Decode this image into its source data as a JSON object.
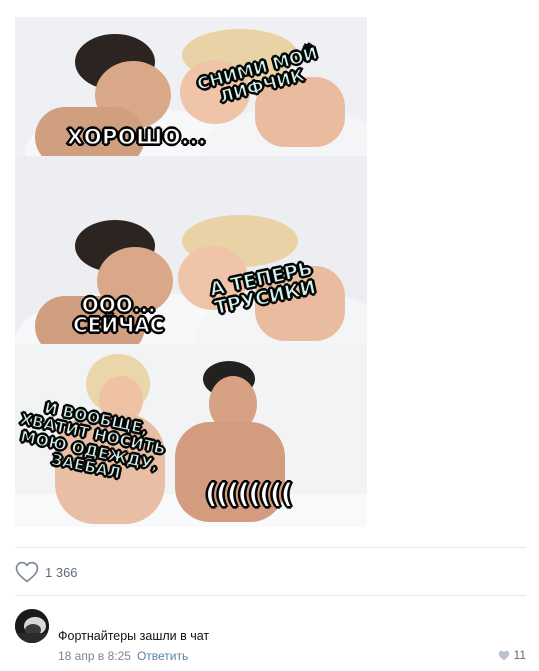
{
  "meme": {
    "panel1": {
      "left_caption": "ХОРОШО...",
      "right_caption": "СНИМИ МОЙ ЛИФЧИК"
    },
    "panel2": {
      "left_caption_line1": "ООО...",
      "left_caption_line2": "СЕЙЧАС",
      "right_caption_line1": "А ТЕПЕРЬ",
      "right_caption_line2": "ТРУСИКИ"
    },
    "panel3": {
      "left_caption_line1": "И ВООБЩЕ,",
      "left_caption_line2": "ХВАТИТ НОСИТЬ",
      "left_caption_line3": "МОЮ ОДЕЖДУ,",
      "left_caption_line4": "ЗАЕБАЛ",
      "right_caption": "(((((((("
    }
  },
  "post": {
    "likes": "1 366",
    "icon": "heart-outline-icon"
  },
  "comment": {
    "text": "Фортнайтеры зашли в чат",
    "date": "18 апр в 8:25",
    "reply_label": "Ответить",
    "likes": "11",
    "icon": "heart-filled-icon"
  },
  "colors": {
    "muted": "#7b8694",
    "link": "#5b7fa6",
    "divider": "#e4e6ea"
  }
}
